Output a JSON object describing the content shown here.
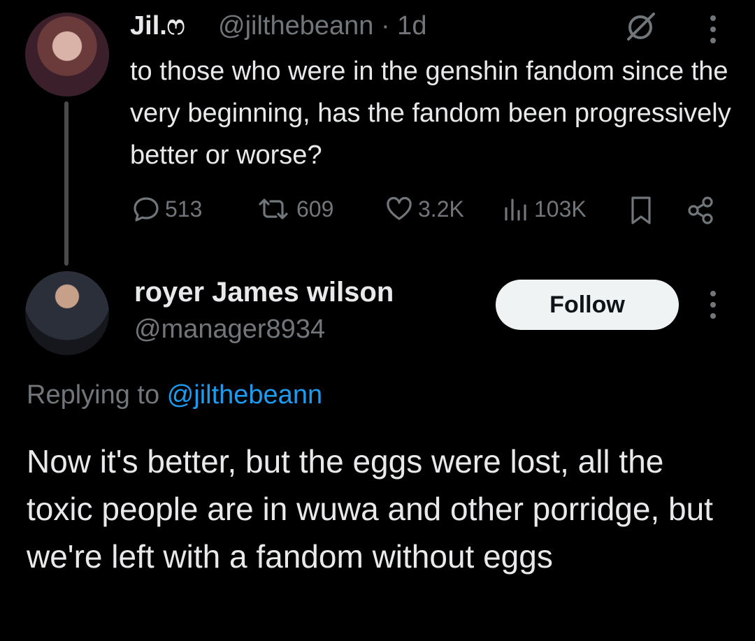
{
  "parent_tweet": {
    "display_name": "Jil.ෆ",
    "handle": "@jilthebeann",
    "time": "· 1d",
    "text": "to those who were in the genshin fandom since the very beginning, has the fandom been progressively better or worse?",
    "actions": {
      "replies": "513",
      "reposts": "609",
      "likes": "3.2K",
      "views": "103K"
    }
  },
  "reply": {
    "display_name": "royer James wilson",
    "handle": "@manager8934",
    "follow_label": "Follow",
    "replying_to_label": "Replying to",
    "replying_to_handle": "@jilthebeann",
    "text": "Now it's better, but the eggs were lost, all the toxic people are in wuwa and other porridge, but we're left with a fandom without eggs"
  },
  "icons": {
    "reply": "reply-icon",
    "repost": "repost-icon",
    "like": "heart-icon",
    "views": "views-icon",
    "bookmark": "bookmark-icon",
    "share": "share-icon",
    "grok": "grok-icon",
    "more": "more-vertical-icon"
  },
  "colors": {
    "background": "#000000",
    "primary_text": "#e7e9ea",
    "secondary_text": "#71767b",
    "link": "#1d9bf0",
    "follow_button_bg": "#eff3f4"
  }
}
